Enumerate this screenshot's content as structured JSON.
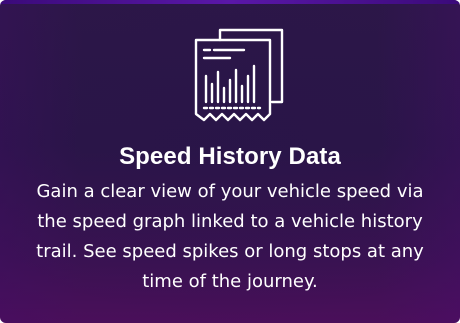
{
  "card": {
    "icon": "report-document-chart-icon",
    "title": "Speed History Data",
    "description": "Gain a clear view of your vehicle speed via the speed graph linked to a vehicle history trail. See speed spikes or long stops at any time of the journey."
  },
  "colors": {
    "background_top": "#2c1748",
    "background_bottom": "#4a0f5a",
    "text": "#ffffff"
  }
}
